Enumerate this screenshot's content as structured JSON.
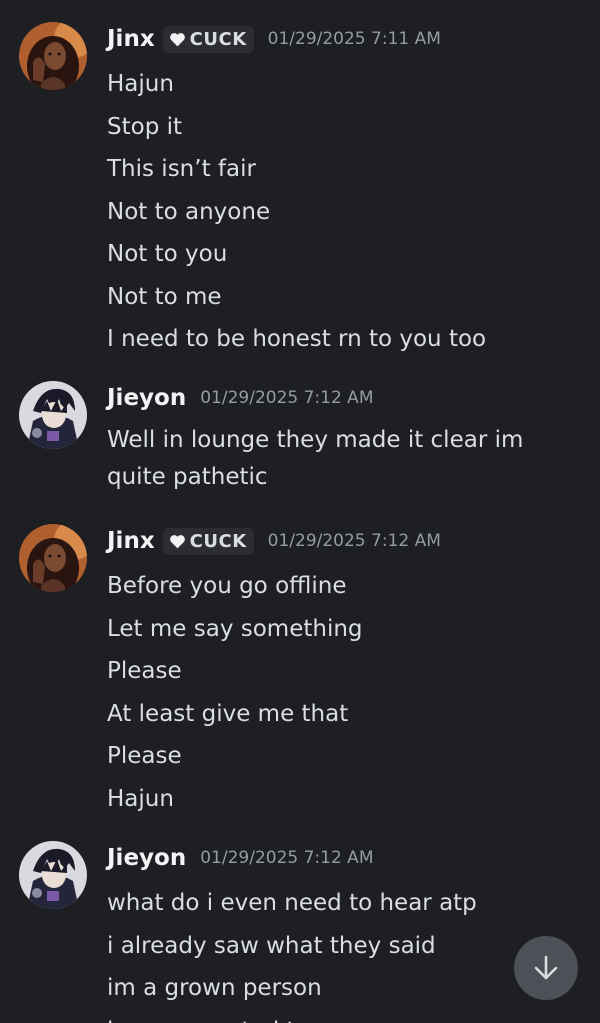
{
  "messages": [
    {
      "username": "Jinx",
      "role_tag": "CUCK",
      "timestamp": "01/29/2025 7:11 AM",
      "avatar": "jinx-avatar",
      "lines": [
        "Hajun",
        "Stop it",
        "This isn’t fair",
        "Not to anyone",
        "Not to you",
        "Not to me",
        "I need to be honest rn to you too"
      ]
    },
    {
      "username": "Jieyon",
      "timestamp": "01/29/2025 7:12 AM",
      "avatar": "jieyon-avatar",
      "lines": [
        "Well in lounge they made it clear im quite pathetic"
      ]
    },
    {
      "username": "Jinx",
      "role_tag": "CUCK",
      "timestamp": "01/29/2025 7:12 AM",
      "avatar": "jinx-avatar",
      "lines": [
        "Before you go offline",
        "Let me say something",
        "Please",
        "At least give me that",
        "Please",
        "Hajun"
      ]
    },
    {
      "username": "Jieyon",
      "timestamp": "01/29/2025 7:12 AM",
      "avatar": "jieyon-avatar",
      "lines": [
        "what do i even need to hear atp",
        "i already saw what they said",
        "im a grown person",
        "i never wanted to grow up"
      ]
    }
  ],
  "scroll_button": {
    "icon": "arrow-down-icon"
  },
  "colors": {
    "background": "#1e1f22",
    "text": "#dbdee1",
    "username": "#f2f3f5",
    "timestamp": "#949ba4",
    "role_tag_bg": "#2b2d31",
    "scroll_button_bg": "#4e5058"
  }
}
